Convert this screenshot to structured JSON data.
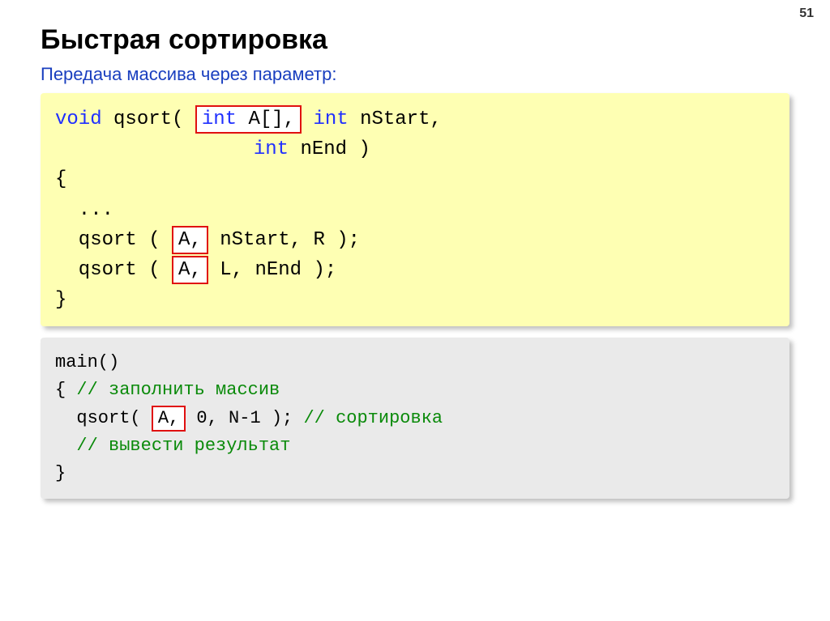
{
  "page_number": "51",
  "title": "Быстрая сортировка",
  "subtitle": "Передача массива через параметр:",
  "code1": {
    "l1_a": "void",
    "l1_b": " qsort( ",
    "l1_box": "int A[],",
    "l1_c": " int",
    "l1_d": " nStart,",
    "l2_a": "                 int",
    "l2_b": " nEnd )",
    "l3": "{",
    "l4": "  ...",
    "l5_a": "  qsort ( ",
    "l5_box": "A,",
    "l5_b": " nStart, R );",
    "l6_a": "  qsort ( ",
    "l6_box": "A,",
    "l6_b": " L, nEnd );",
    "l7": "}"
  },
  "code2": {
    "l1": "main()",
    "l2_a": "{ ",
    "l2_b": "// заполнить массив",
    "l3_a": "  qsort( ",
    "l3_box": "A,",
    "l3_b": " 0, N-1 ); ",
    "l3_c": "// сортировка",
    "l4": "  // вывести результат",
    "l5": "}"
  }
}
